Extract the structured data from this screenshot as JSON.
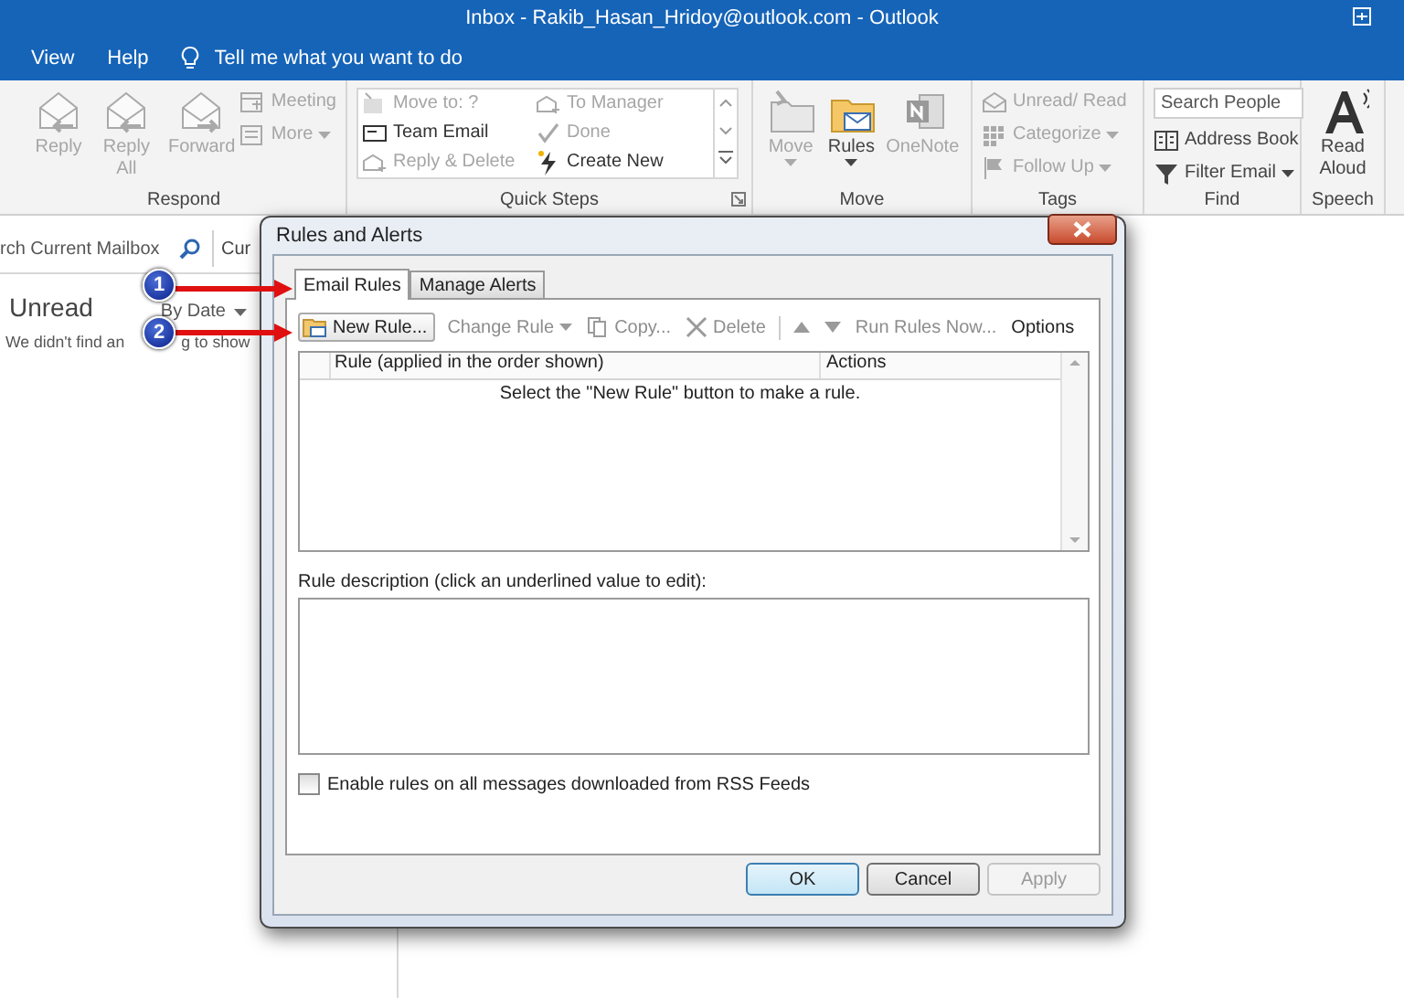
{
  "window": {
    "title": "Inbox - Rakib_Hasan_Hridoy@outlook.com  -  Outlook"
  },
  "menu": {
    "items": [
      {
        "label": "View"
      },
      {
        "label": "Help"
      }
    ],
    "tell_me": "Tell me what you want to do"
  },
  "ribbon": {
    "groups": [
      {
        "label": "Respond",
        "launcher": false,
        "items": [
          {
            "kind": "large",
            "label": "Reply",
            "disabled": true,
            "dropdown": false
          },
          {
            "kind": "large",
            "label": "Reply All",
            "disabled": true,
            "dropdown": false
          },
          {
            "kind": "large",
            "label": "Forward",
            "disabled": true,
            "dropdown": false
          },
          {
            "kind": "small",
            "label": "Meeting",
            "disabled": true,
            "dropdown": false
          },
          {
            "kind": "small",
            "label": "More",
            "disabled": true,
            "dropdown": true
          }
        ]
      },
      {
        "label": "Quick Steps",
        "launcher": true,
        "items": [
          {
            "kind": "gallery",
            "label": "Move to: ?",
            "disabled": true
          },
          {
            "kind": "gallery",
            "label": "Team Email",
            "disabled": false
          },
          {
            "kind": "gallery",
            "label": "Reply & Delete",
            "disabled": true
          },
          {
            "kind": "gallery",
            "label": "To Manager",
            "disabled": true
          },
          {
            "kind": "gallery",
            "label": "Done",
            "disabled": true
          },
          {
            "kind": "gallery",
            "label": "Create New",
            "disabled": false
          }
        ]
      },
      {
        "label": "Move",
        "launcher": false,
        "items": [
          {
            "kind": "large",
            "label": "Move",
            "disabled": true,
            "dropdown": true
          },
          {
            "kind": "large",
            "label": "Rules",
            "disabled": false,
            "dropdown": true
          },
          {
            "kind": "large",
            "label": "OneNote",
            "disabled": true,
            "dropdown": false
          }
        ]
      },
      {
        "label": "Tags",
        "launcher": false,
        "items": [
          {
            "kind": "small",
            "label": "Unread/ Read",
            "disabled": true,
            "dropdown": false
          },
          {
            "kind": "small",
            "label": "Categorize",
            "disabled": true,
            "dropdown": true
          },
          {
            "kind": "small",
            "label": "Follow Up",
            "disabled": true,
            "dropdown": true
          }
        ]
      },
      {
        "label": "Find",
        "launcher": false,
        "items": [
          {
            "kind": "field",
            "placeholder": "Search People"
          },
          {
            "kind": "small",
            "label": "Address Book",
            "disabled": false,
            "dropdown": false
          },
          {
            "kind": "small",
            "label": "Filter Email",
            "disabled": false,
            "dropdown": true
          }
        ]
      },
      {
        "label": "Speech",
        "launcher": false,
        "items": [
          {
            "kind": "large",
            "label": "Read Aloud",
            "disabled": false,
            "dropdown": false
          }
        ]
      }
    ]
  },
  "mail": {
    "search_placeholder": "rch Current Mailbox",
    "scope": "Cur",
    "filter": "Unread",
    "sort": "By Date",
    "empty_before": "We didn't find an",
    "empty_after": "g to show"
  },
  "dialog": {
    "title": "Rules and Alerts",
    "tabs": [
      {
        "label": "Email Rules",
        "selected": true
      },
      {
        "label": "Manage Alerts",
        "selected": false
      }
    ],
    "toolbar": [
      {
        "kind": "new",
        "label": "New Rule...",
        "disabled": false
      },
      {
        "kind": "menu",
        "label": "Change Rule",
        "disabled": true
      },
      {
        "kind": "copy",
        "label": "Copy...",
        "disabled": true
      },
      {
        "kind": "delete",
        "label": "Delete",
        "disabled": true
      },
      {
        "kind": "separator"
      },
      {
        "kind": "up",
        "disabled": true
      },
      {
        "kind": "down",
        "disabled": true
      },
      {
        "kind": "link",
        "label": "Run Rules Now...",
        "disabled": true
      },
      {
        "kind": "link",
        "label": "Options",
        "disabled": false
      }
    ],
    "columns": [
      "Rule (applied in the order shown)",
      "Actions"
    ],
    "empty_message": "Select the \"New Rule\" button to make a rule.",
    "description_label": "Rule description (click an underlined value to edit):",
    "rss_checkbox": {
      "label": "Enable rules on all messages downloaded from RSS Feeds",
      "checked": false
    },
    "buttons": [
      {
        "label": "OK",
        "default": true,
        "disabled": false
      },
      {
        "label": "Cancel",
        "default": false,
        "disabled": false
      },
      {
        "label": "Apply",
        "default": false,
        "disabled": true
      }
    ]
  },
  "annotations": [
    {
      "label": "1"
    },
    {
      "label": "2"
    }
  ]
}
